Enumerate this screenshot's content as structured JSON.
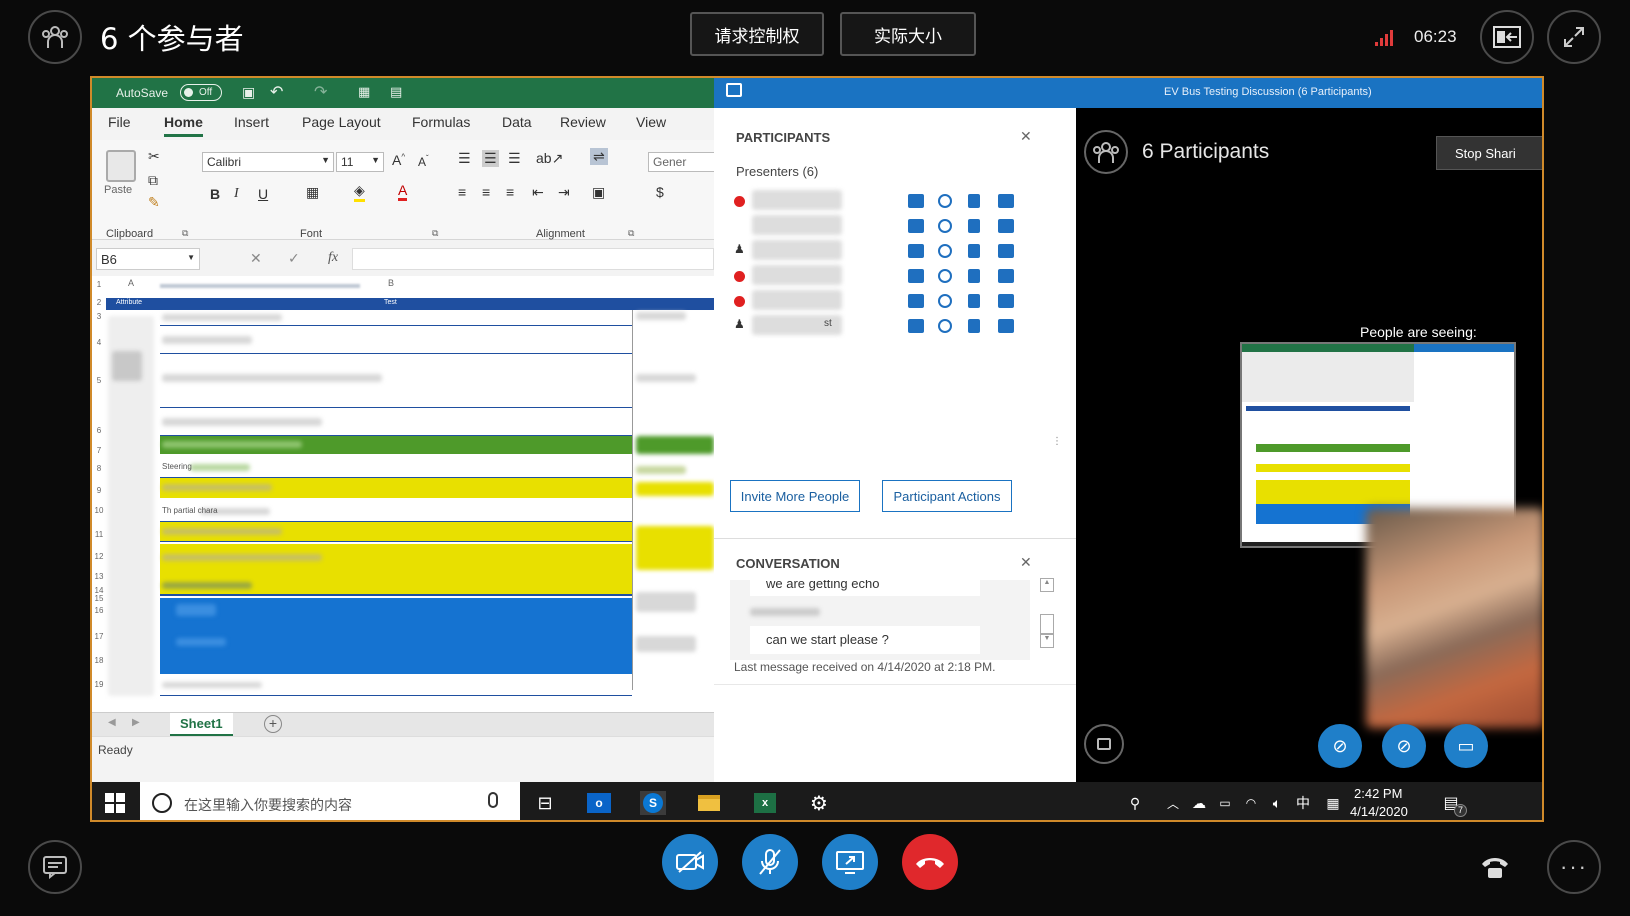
{
  "header": {
    "participant_count_title": "6 个参与者",
    "request_control": "请求控制权",
    "actual_size": "实际大小",
    "time": "06:23"
  },
  "excel": {
    "autosave": "AutoSave",
    "autosave_state": "Off",
    "menu": [
      "File",
      "Home",
      "Insert",
      "Page Layout",
      "Formulas",
      "Data",
      "Review",
      "View"
    ],
    "font_name": "Calibri",
    "font_size": "11",
    "number_format": "Gener",
    "ribbon_groups": [
      "Clipboard",
      "Font",
      "Alignment"
    ],
    "paste_label": "Paste",
    "name_box": "B6",
    "fx": "fx",
    "col_headers": [
      "A",
      "B"
    ],
    "header_cells": [
      "Attribute",
      "Test"
    ],
    "row_numbers": [
      "1",
      "2",
      "3",
      "4",
      "5",
      "6",
      "7",
      "8",
      "9",
      "10",
      "11",
      "12",
      "13",
      "14",
      "15",
      "16",
      "17",
      "18",
      "19"
    ],
    "sheet_tab": "Sheet1",
    "status": "Ready",
    "fragment_row8": "Steering",
    "fragment_row10": "Th    partial chara    "
  },
  "lync": {
    "window_title": "EV Bus Testing Discussion (6 Participants)",
    "participants_header": "PARTICIPANTS",
    "presenters": "Presenters (6)",
    "participant_6_fragment": "st",
    "invite_button": "Invite More People",
    "actions_button": "Participant Actions",
    "conversation_header": "CONVERSATION",
    "msg_partial": "we are getting echo",
    "msg_last": "can we start please ?",
    "last_received": "Last message received on 4/14/2020 at 2:18 PM.",
    "stage_title": "6 Participants",
    "stop_sharing": "Stop Shari",
    "people_seeing": "People are seeing:"
  },
  "taskbar": {
    "search_placeholder": "在这里输入你要搜索的内容",
    "ime": "中",
    "time": "2:42 PM",
    "date": "4/14/2020",
    "notif_count": "7"
  },
  "colors": {
    "excel_green": "#217346",
    "lync_blue": "#1a73c2",
    "row_green": "#4e9a2a",
    "row_yellow": "#e8e000",
    "row_blue": "#1573d1",
    "hangup_red": "#e0282c",
    "control_blue": "#1f7fc9"
  }
}
